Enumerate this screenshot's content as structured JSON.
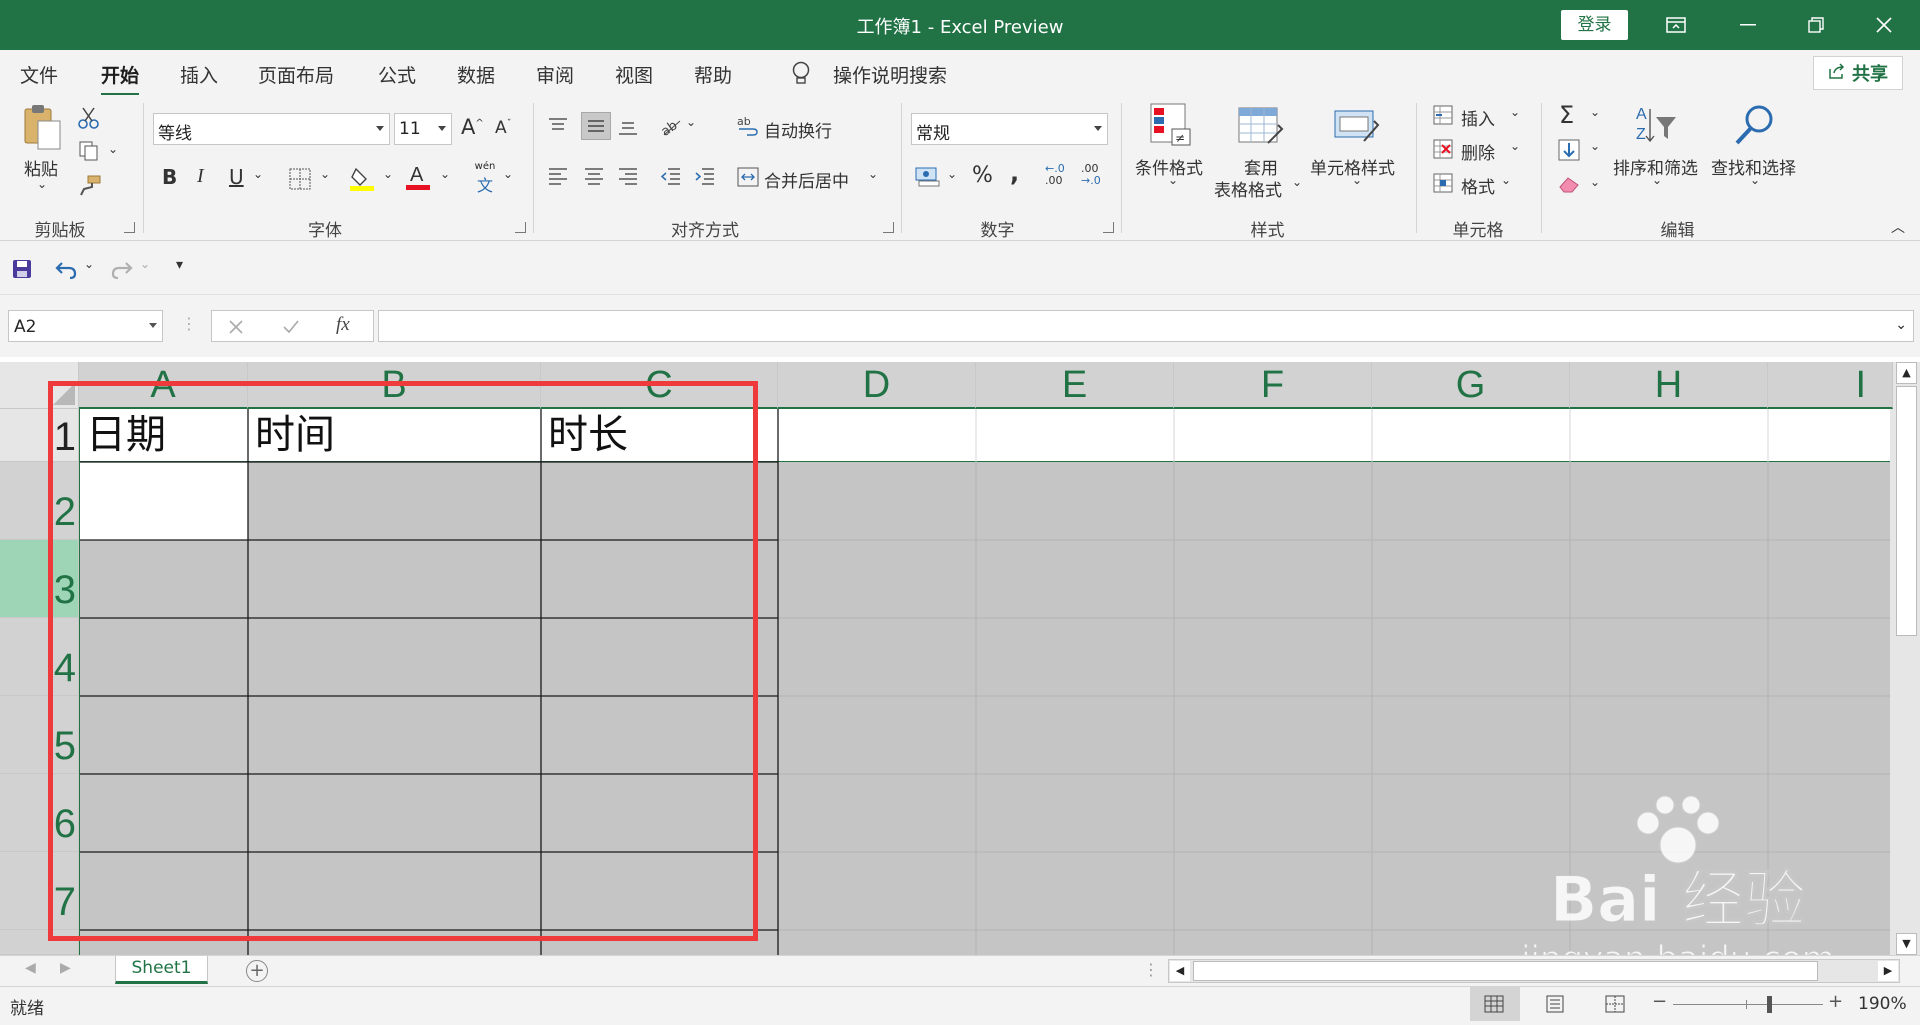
{
  "window": {
    "title": "工作簿1  -  Excel Preview",
    "login_label": "登录"
  },
  "tabs": [
    "文件",
    "开始",
    "插入",
    "页面布局",
    "公式",
    "数据",
    "审阅",
    "视图",
    "帮助"
  ],
  "tell_me": "操作说明搜索",
  "share_label": "共享",
  "ribbon": {
    "clipboard": {
      "paste": "粘贴",
      "group": "剪贴板"
    },
    "font": {
      "name": "等线",
      "size": "11",
      "group": "字体",
      "bold": "B",
      "italic": "I",
      "underline": "U",
      "grow": "A",
      "shrink": "A",
      "phonetic": "wén"
    },
    "alignment": {
      "wrap": "自动换行",
      "merge": "合并后居中",
      "group": "对齐方式"
    },
    "number": {
      "format": "常规",
      "percent": "%",
      "comma": ",",
      "group": "数字",
      "inc_dec": ".00",
      "dec_dec": ".0"
    },
    "styles": {
      "conditional": "条件格式",
      "table_a": "套用",
      "table_b": "表格格式",
      "cell_styles": "单元格样式",
      "group": "样式"
    },
    "cells": {
      "insert": "插入",
      "delete": "删除",
      "format": "格式",
      "group": "单元格"
    },
    "editing": {
      "sum": "Σ",
      "sort": "排序和筛选",
      "find": "查找和选择",
      "group": "编辑"
    }
  },
  "formula_bar": {
    "name_box": "A2",
    "fx": "fx",
    "formula": ""
  },
  "columns": [
    "A",
    "B",
    "C",
    "D",
    "E",
    "F",
    "G",
    "H",
    "I"
  ],
  "rows": [
    "1",
    "2",
    "3",
    "4",
    "5",
    "6",
    "7"
  ],
  "cells": {
    "A1": "日期",
    "B1": "时间",
    "C1": "时长"
  },
  "sheet_tab": "Sheet1",
  "status": {
    "mode": "就绪",
    "zoom": "190%"
  },
  "watermark": {
    "brand": "Bai  经验",
    "url": "jingyan.baidu.com"
  },
  "colors": {
    "accent": "#217346",
    "highlight_box": "#ee3a3a",
    "selection": "#c5c5c5"
  }
}
